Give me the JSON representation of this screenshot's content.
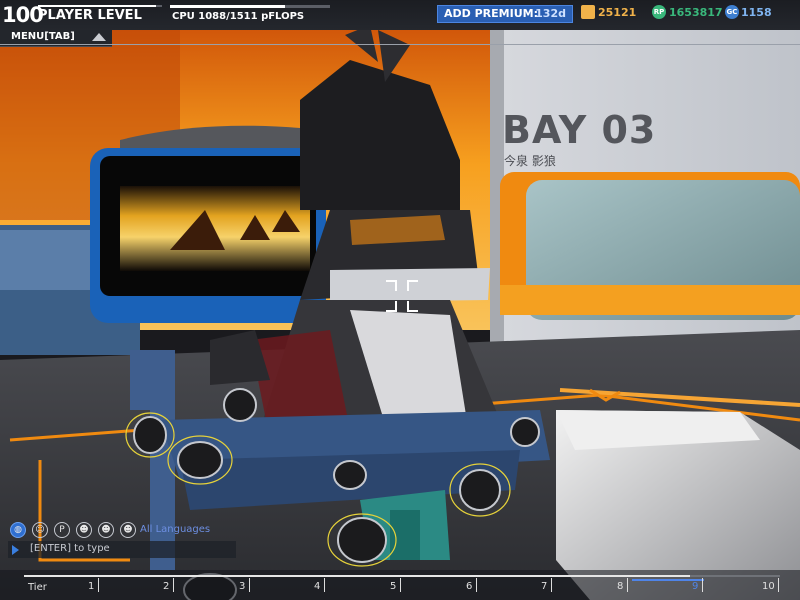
{
  "player": {
    "level": "100",
    "level_label": "PLAYER LEVEL",
    "level_progress": 0.95
  },
  "cpu": {
    "label": "CPU 1088/1511 pFLOPS",
    "used": 1088,
    "max": 1511
  },
  "premium": {
    "label": "ADD PREMIUM:",
    "days": "132d"
  },
  "currencies": [
    {
      "icon": "robits-crate-icon",
      "value": "25121",
      "color": "#f0b24a",
      "icon_text": ""
    },
    {
      "icon": "rp-coin-icon",
      "value": "1653817",
      "color": "#39b77b",
      "icon_text": "RP"
    },
    {
      "icon": "gc-coin-icon",
      "value": "1158",
      "color": "#7fb4f0",
      "icon_text": "GC"
    }
  ],
  "menu": {
    "label": "MENU[TAB]"
  },
  "scene": {
    "bay_title": "BAY 03",
    "bay_subtitle": "今泉 影狼"
  },
  "chat": {
    "icons": [
      "globe-icon",
      "person-icon",
      "party-icon",
      "friends-icon",
      "clan-icon"
    ],
    "filter": "All Languages",
    "hint": "[ENTER] to type"
  },
  "tiers": {
    "label": "Tier",
    "numbers": [
      "1",
      "2",
      "3",
      "4",
      "5",
      "6",
      "7",
      "8",
      "9",
      "10"
    ],
    "active": "9"
  },
  "colors": {
    "accent_blue": "#2a5fb3",
    "bay_orange": "#f08a10",
    "tier_active": "#4f84e8"
  }
}
